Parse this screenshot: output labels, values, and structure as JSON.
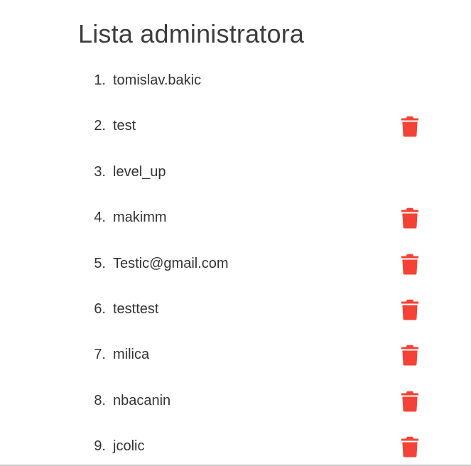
{
  "page": {
    "title": "Lista administratora"
  },
  "delete_icon": {
    "name": "trash-icon",
    "color": "#f44336"
  },
  "admins": [
    {
      "number": "1.",
      "name": "tomislav.bakic",
      "deletable": false
    },
    {
      "number": "2.",
      "name": "test",
      "deletable": true
    },
    {
      "number": "3.",
      "name": "level_up",
      "deletable": false
    },
    {
      "number": "4.",
      "name": "makimm",
      "deletable": true
    },
    {
      "number": "5.",
      "name": "Testic@gmail.com",
      "deletable": true
    },
    {
      "number": "6.",
      "name": "testtest",
      "deletable": true
    },
    {
      "number": "7.",
      "name": "milica",
      "deletable": true
    },
    {
      "number": "8.",
      "name": "nbacanin",
      "deletable": true
    },
    {
      "number": "9.",
      "name": "jcolic",
      "deletable": true
    }
  ]
}
